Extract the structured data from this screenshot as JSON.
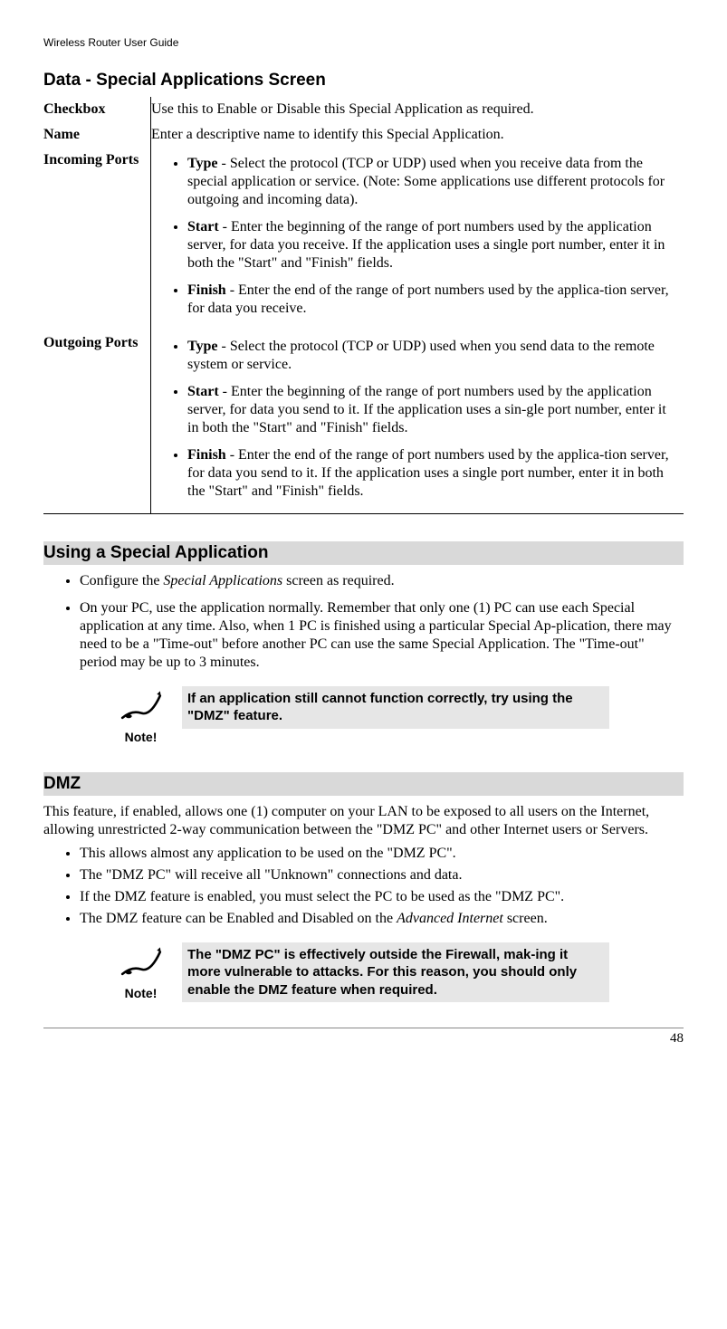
{
  "running_header": "Wireless Router User Guide",
  "section_title": "Data - Special Applications Screen",
  "table": {
    "rows": [
      {
        "label": "Checkbox",
        "desc": "Use this to Enable or Disable this Special Application as required."
      },
      {
        "label": "Name",
        "desc": "Enter a descriptive name to identify this Special Application."
      },
      {
        "label": "Incoming Ports",
        "bullets": [
          {
            "head": "Type",
            "text": " - Select the protocol (TCP or UDP) used when you receive data from the special application or service. (Note: Some applications use different protocols for outgoing and incoming data)."
          },
          {
            "head": "Start",
            "text": " - Enter the beginning of the range of port numbers used by the application server, for data you receive. If the application uses a single port number, enter it in both the \"Start\" and \"Finish\" fields."
          },
          {
            "head": "Finish",
            "text": " - Enter the end of the range of port numbers used by the applica-tion server, for data you receive."
          }
        ]
      },
      {
        "label": "Outgoing Ports",
        "bullets": [
          {
            "head": "Type",
            "text": " - Select the protocol (TCP or UDP) used when you send data to the remote system or service."
          },
          {
            "head": "Start",
            "text": " - Enter the beginning of the range of port numbers used by the application server, for data you send to it. If the application uses a sin-gle port number, enter it in both the \"Start\" and \"Finish\" fields."
          },
          {
            "head": "Finish",
            "text": " - Enter the end of the range of port numbers used by the applica-tion server, for data you send to it. If the application uses a single port number, enter it in both the \"Start\" and \"Finish\" fields."
          }
        ]
      }
    ]
  },
  "using_heading": "Using a Special Application",
  "using_bullets": [
    {
      "pre": "Configure the ",
      "ital": "Special Applications",
      "post": " screen as required."
    },
    {
      "plain": "On your PC, use the application normally. Remember that only one (1) PC can use each Special application at any time. Also, when 1 PC is finished using a particular Special Ap-plication, there may need to be a \"Time-out\" before another PC can use the same Special Application. The \"Time-out\" period may be up to 3 minutes."
    }
  ],
  "note1_text": "If an application still cannot function correctly, try using the \"DMZ\" feature.",
  "note_caption": "Note!",
  "dmz_heading": "DMZ",
  "dmz_intro": "This feature, if enabled, allows one (1) computer on your LAN to be exposed to all users on the Internet, allowing unrestricted 2-way communication between the \"DMZ PC\" and other Internet users or Servers.",
  "dmz_bullets": [
    "This allows almost any application to be used on the \"DMZ PC\".",
    "The \"DMZ PC\" will receive all \"Unknown\" connections and data.",
    "If the DMZ feature is enabled, you must select the PC to be used as the \"DMZ PC\"."
  ],
  "dmz_last_pre": "The DMZ feature can be Enabled and Disabled on the ",
  "dmz_last_ital": "Advanced Internet",
  "dmz_last_post": " screen.",
  "note2_text": "The \"DMZ PC\" is effectively outside the Firewall, mak-ing it more vulnerable to attacks. For this reason, you should only enable the DMZ feature when required.",
  "page_number": "48"
}
